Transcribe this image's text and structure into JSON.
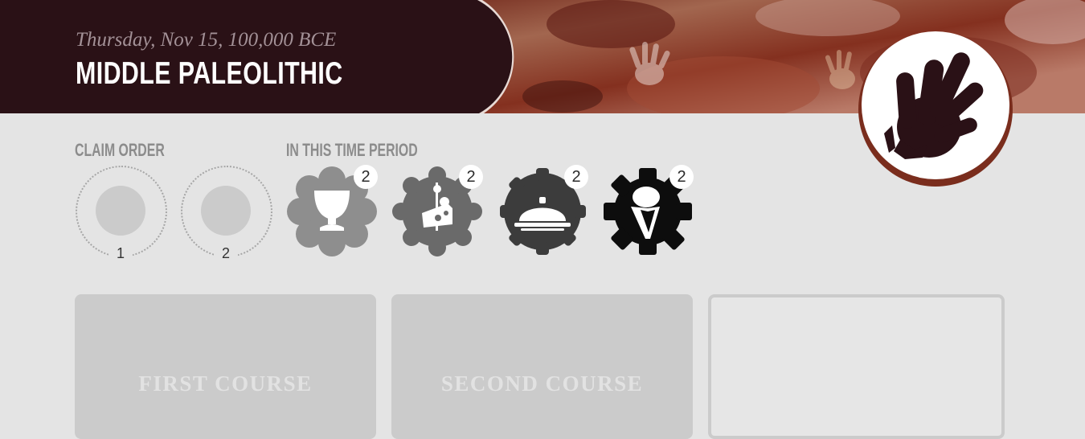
{
  "header": {
    "date": "Thursday, Nov 15, 100,000 BCE",
    "period_title": "MIDDLE PALEOLITHIC",
    "badge_icon": "hand-print-icon"
  },
  "claim_order": {
    "label": "CLAIM ORDER",
    "slots": [
      {
        "number": "1"
      },
      {
        "number": "2"
      }
    ]
  },
  "time_period": {
    "label": "IN THIS TIME PERIOD",
    "tokens": [
      {
        "icon": "goblet-icon",
        "count": "2",
        "color": "#8e8e8e"
      },
      {
        "icon": "cheese-icon",
        "count": "2",
        "color": "#6a6a6a"
      },
      {
        "icon": "cloche-icon",
        "count": "2",
        "color": "#3c3c3c"
      },
      {
        "icon": "chef-icon",
        "count": "2",
        "color": "#0d0d0d"
      }
    ]
  },
  "courses": [
    {
      "label": "FIRST COURSE"
    },
    {
      "label": "SECOND COURSE"
    },
    {
      "label": ""
    }
  ],
  "colors": {
    "header_panel": "#2a1116",
    "page_background": "#e4e4e4",
    "card": "#cbcbcb"
  }
}
